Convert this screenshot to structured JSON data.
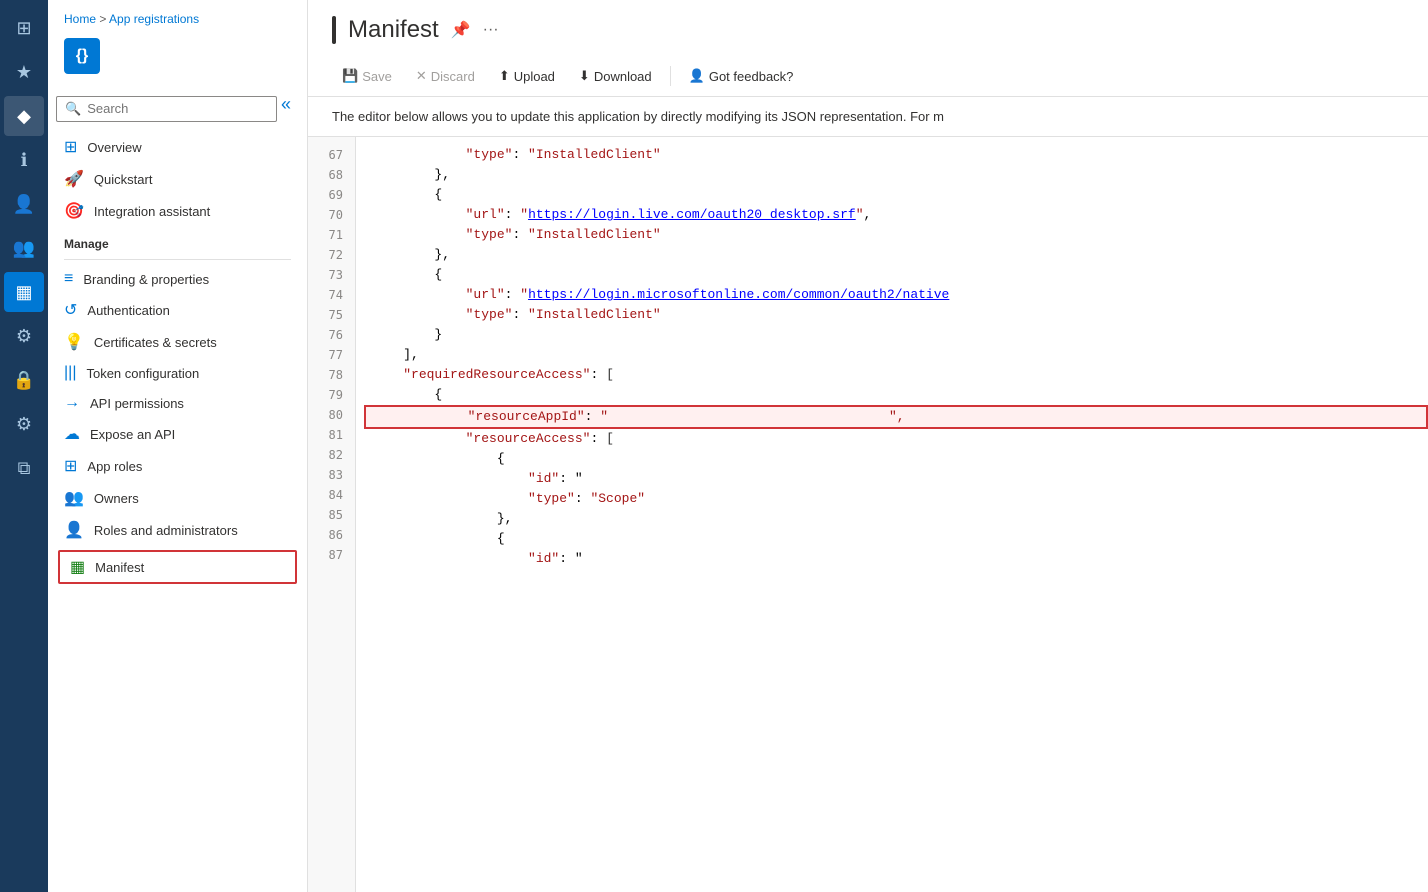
{
  "iconBar": {
    "items": [
      {
        "name": "home-icon",
        "symbol": "⊞",
        "active": false
      },
      {
        "name": "favorites-icon",
        "symbol": "★",
        "active": false
      },
      {
        "name": "diamond-icon",
        "symbol": "◆",
        "active": false
      },
      {
        "name": "info-icon",
        "symbol": "ℹ",
        "active": false
      },
      {
        "name": "person-icon",
        "symbol": "👤",
        "active": false
      },
      {
        "name": "group-icon",
        "symbol": "👥",
        "active": false
      },
      {
        "name": "table-icon",
        "symbol": "▦",
        "active": true
      },
      {
        "name": "settings-icon",
        "symbol": "⚙",
        "active": false
      },
      {
        "name": "lock-icon",
        "symbol": "🔒",
        "active": false
      },
      {
        "name": "gear-icon",
        "symbol": "⚙",
        "active": false
      },
      {
        "name": "layers-icon",
        "symbol": "⧉",
        "active": false
      }
    ]
  },
  "breadcrumb": {
    "home": "Home",
    "separator": " > ",
    "current": "App registrations"
  },
  "appIcon": {
    "symbol": "{}"
  },
  "search": {
    "placeholder": "Search",
    "value": ""
  },
  "nav": {
    "topItems": [
      {
        "label": "Overview",
        "icon": "⊞"
      },
      {
        "label": "Quickstart",
        "icon": "🚀"
      },
      {
        "label": "Integration assistant",
        "icon": "🎯"
      }
    ],
    "manageLabel": "Manage",
    "manageItems": [
      {
        "label": "Branding & properties",
        "icon": "≡",
        "iconColor": "#0078d4"
      },
      {
        "label": "Authentication",
        "icon": "↺",
        "iconColor": "#0078d4"
      },
      {
        "label": "Certificates & secrets",
        "icon": "💡",
        "iconColor": "#f2c811"
      },
      {
        "label": "Token configuration",
        "icon": "|||",
        "iconColor": "#0078d4"
      },
      {
        "label": "API permissions",
        "icon": "→",
        "iconColor": "#0078d4"
      },
      {
        "label": "Expose an API",
        "icon": "☁",
        "iconColor": "#0078d4"
      },
      {
        "label": "App roles",
        "icon": "⊞",
        "iconColor": "#0078d4"
      },
      {
        "label": "Owners",
        "icon": "👥",
        "iconColor": "#0078d4"
      },
      {
        "label": "Roles and administrators",
        "icon": "👤",
        "iconColor": "#0078d4"
      },
      {
        "label": "Manifest",
        "icon": "▦",
        "iconColor": "#107c10",
        "active": true
      }
    ]
  },
  "page": {
    "title": "Manifest",
    "descriptionText": "The editor below allows you to update this application by directly modifying its JSON representation. For m"
  },
  "toolbar": {
    "save": "Save",
    "discard": "Discard",
    "upload": "Upload",
    "download": "Download",
    "feedback": "Got feedback?"
  },
  "codeLines": [
    {
      "num": "67",
      "content": "            \"type\": \"InstalledClient\"",
      "type": "normal"
    },
    {
      "num": "68",
      "content": "        },",
      "type": "normal"
    },
    {
      "num": "69",
      "content": "        {",
      "type": "normal"
    },
    {
      "num": "70",
      "content": "            \"url\": \"https://login.live.com/oauth20_desktop.srf\",",
      "type": "url70"
    },
    {
      "num": "71",
      "content": "            \"type\": \"InstalledClient\"",
      "type": "normal"
    },
    {
      "num": "72",
      "content": "        },",
      "type": "normal"
    },
    {
      "num": "73",
      "content": "        {",
      "type": "normal"
    },
    {
      "num": "74",
      "content": "            \"url\": \"https://login.microsoftonline.com/common/oauth2/native",
      "type": "url74"
    },
    {
      "num": "75",
      "content": "            \"type\": \"InstalledClient\"",
      "type": "normal"
    },
    {
      "num": "76",
      "content": "        }",
      "type": "normal"
    },
    {
      "num": "77",
      "content": "    ],",
      "type": "normal"
    },
    {
      "num": "78",
      "content": "    \"requiredResourceAccess\": [",
      "type": "normal"
    },
    {
      "num": "79",
      "content": "        {",
      "type": "normal"
    },
    {
      "num": "80",
      "content": "            \"resourceAppId\": \"",
      "type": "highlighted"
    },
    {
      "num": "81",
      "content": "            \"resourceAccess\": [",
      "type": "normal"
    },
    {
      "num": "82",
      "content": "                {",
      "type": "normal"
    },
    {
      "num": "83",
      "content": "                    \"id\": \"",
      "type": "normal"
    },
    {
      "num": "84",
      "content": "                    \"type\": \"Scope\"",
      "type": "normal"
    },
    {
      "num": "85",
      "content": "                },",
      "type": "normal"
    },
    {
      "num": "86",
      "content": "                {",
      "type": "normal"
    },
    {
      "num": "87",
      "content": "                    \"id\": \"",
      "type": "normal"
    }
  ],
  "colors": {
    "accent": "#0078d4",
    "highlight": "#d13438",
    "jsonKey": "#a31515",
    "jsonUrl": "#0000ff",
    "activeNavBorder": "#d13438"
  }
}
